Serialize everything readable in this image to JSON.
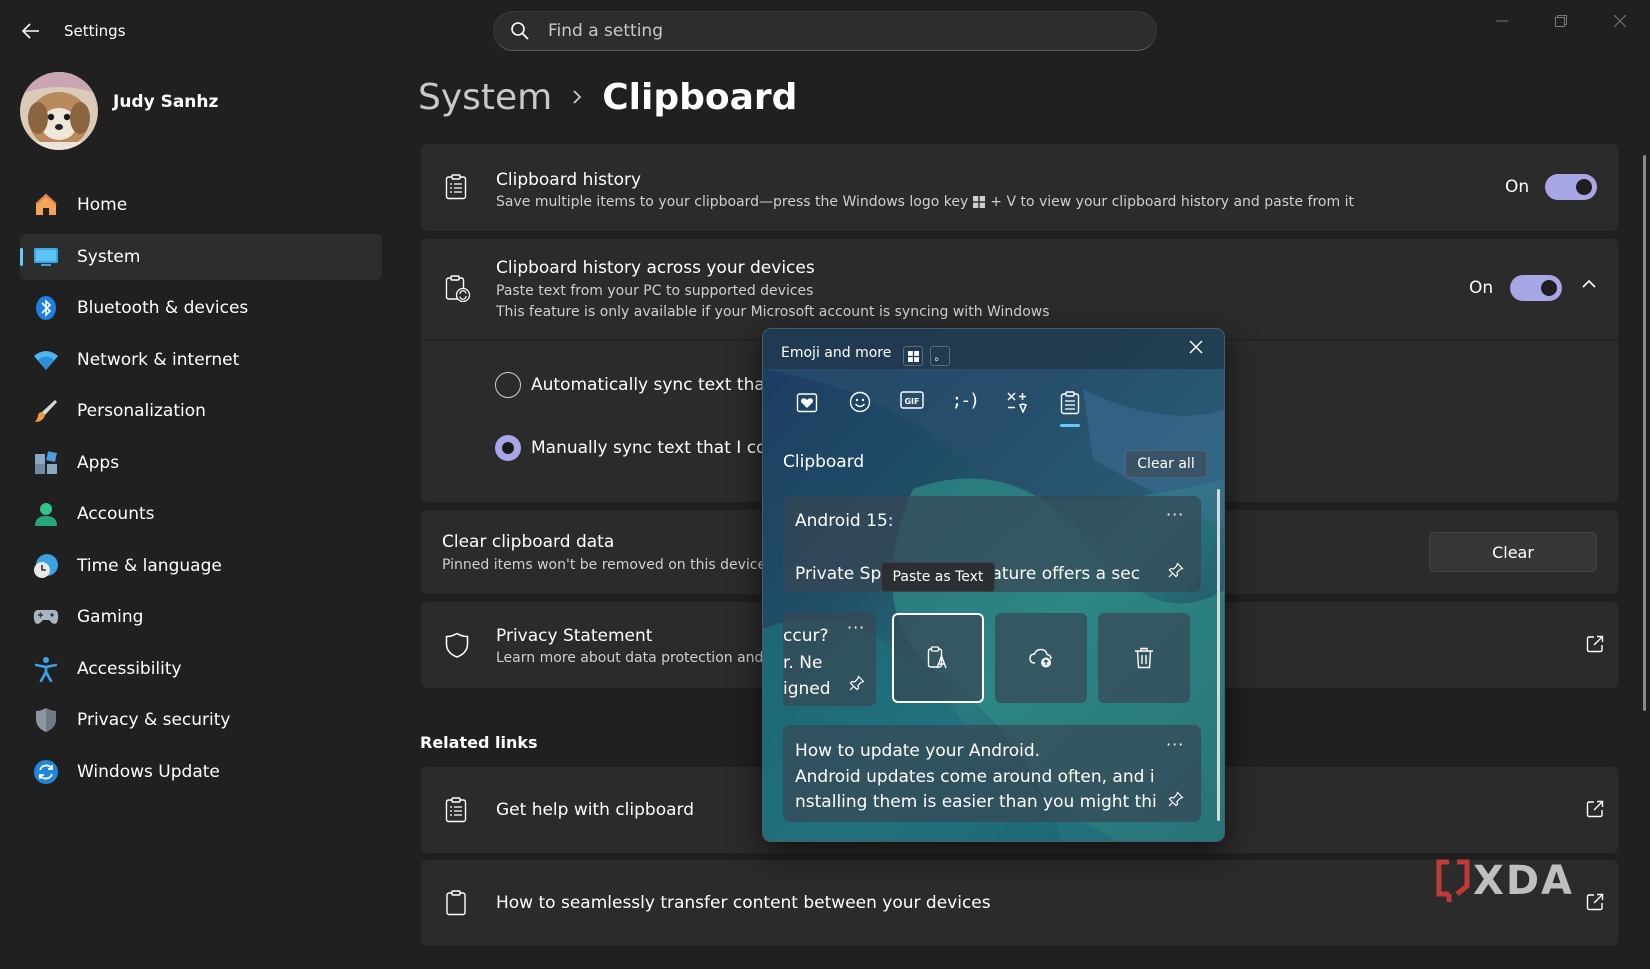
{
  "window": {
    "app_title": "Settings",
    "search_placeholder": "Find a setting"
  },
  "user": {
    "name": "Judy Sanhz"
  },
  "sidebar": {
    "items": [
      {
        "label": "Home",
        "icon": "home-icon"
      },
      {
        "label": "System",
        "icon": "system-icon",
        "active": true
      },
      {
        "label": "Bluetooth & devices",
        "icon": "bluetooth-icon"
      },
      {
        "label": "Network & internet",
        "icon": "wifi-icon"
      },
      {
        "label": "Personalization",
        "icon": "brush-icon"
      },
      {
        "label": "Apps",
        "icon": "apps-icon"
      },
      {
        "label": "Accounts",
        "icon": "account-icon"
      },
      {
        "label": "Time & language",
        "icon": "clock-globe-icon"
      },
      {
        "label": "Gaming",
        "icon": "gamepad-icon"
      },
      {
        "label": "Accessibility",
        "icon": "accessibility-icon"
      },
      {
        "label": "Privacy & security",
        "icon": "shield-icon"
      },
      {
        "label": "Windows Update",
        "icon": "update-icon"
      }
    ]
  },
  "breadcrumb": {
    "parent": "System",
    "current": "Clipboard"
  },
  "settings": {
    "history": {
      "title": "Clipboard history",
      "desc_before": "Save multiple items to your clipboard—press the Windows logo key",
      "desc_after": "+ V to view your clipboard history and paste from it",
      "state": "On"
    },
    "across_devices": {
      "title": "Clipboard history across your devices",
      "desc1": "Paste text from your PC to supported devices",
      "desc2": "This feature is only available if your Microsoft account is syncing with Windows",
      "state": "On",
      "options": [
        {
          "label": "Automatically sync text that I",
          "checked": false
        },
        {
          "label": "Manually sync text that I copy",
          "checked": true
        }
      ]
    },
    "clear": {
      "title": "Clear clipboard data",
      "desc": "Pinned items won't be removed on this device",
      "button": "Clear"
    },
    "privacy": {
      "title": "Privacy Statement",
      "desc": "Learn more about data protection and"
    }
  },
  "related": {
    "heading": "Related links",
    "links": [
      {
        "label": "Get help with clipboard"
      },
      {
        "label": "How to seamlessly transfer content between your devices"
      }
    ]
  },
  "emoji_panel": {
    "title": "Emoji and more",
    "key_badge_2": "。",
    "tabs": [
      {
        "name": "favorites-tab",
        "icon": "heart-clipboard-icon"
      },
      {
        "name": "emoji-tab",
        "icon": "smiley-icon"
      },
      {
        "name": "gif-tab",
        "icon": "gif-icon",
        "text": "GIF"
      },
      {
        "name": "kaomoji-tab",
        "icon": "kaomoji-icon",
        "text": ";-)"
      },
      {
        "name": "symbols-tab",
        "icon": "symbols-icon"
      },
      {
        "name": "clipboard-tab",
        "icon": "clipboard-icon",
        "active": true
      }
    ],
    "section": "Clipboard",
    "clear_all": "Clear all",
    "items": [
      {
        "line1": "Android 15:",
        "line2_left": "Private Spa",
        "line2_right": "feature offers a sec",
        "more": "···"
      },
      {
        "lines": [
          "ccur?",
          "r. Ne",
          "igned"
        ],
        "more": "···"
      },
      {
        "lines": [
          "How to update your Android.",
          "Android updates come around often, and i",
          "nstalling them is easier than you might thi"
        ],
        "more": "···"
      }
    ],
    "tooltip": "Paste as Text",
    "actions": [
      "paste-as-text-icon",
      "cloud-sync-icon",
      "delete-icon"
    ]
  },
  "watermark": "XDA",
  "colors": {
    "accent": "#60cdff",
    "toggle_on": "#a9a6e6",
    "background": "#202020",
    "card": "#2b2b2b"
  }
}
